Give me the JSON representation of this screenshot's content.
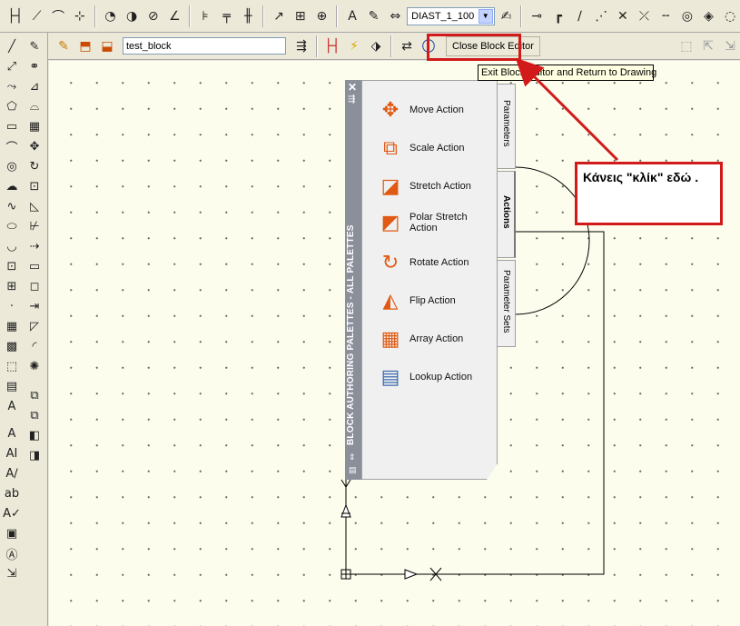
{
  "top_toolbar": {
    "icons": [
      "dim-linear-icon",
      "dim-aligned-icon",
      "dim-arc-icon",
      "dim-ordinate-icon",
      "dim-radius-icon",
      "dim-jogged-icon",
      "dim-diameter-icon",
      "dim-angular-icon",
      "quick-dim-icon",
      "baseline-icon",
      "continue-icon",
      "leader-icon",
      "tolerance-icon",
      "center-mark-icon",
      "dim-edit-icon",
      "dim-text-edit-icon"
    ],
    "dimstyle_value": "DIAST_1_100"
  },
  "block_toolbar": {
    "block_name": "test_block",
    "close_label": "Close Block Editor",
    "tooltip": "Exit Block Editor and Return to Drawing"
  },
  "palette": {
    "title": "BLOCK AUTHORING PALETTES - ALL PALETTES",
    "actions": [
      {
        "label": "Move Action",
        "icon": "move-action-icon"
      },
      {
        "label": "Scale Action",
        "icon": "scale-action-icon"
      },
      {
        "label": "Stretch Action",
        "icon": "stretch-action-icon"
      },
      {
        "label": "Polar Stretch Action",
        "icon": "polar-stretch-action-icon"
      },
      {
        "label": "Rotate Action",
        "icon": "rotate-action-icon"
      },
      {
        "label": "Flip Action",
        "icon": "flip-action-icon"
      },
      {
        "label": "Array Action",
        "icon": "array-action-icon"
      },
      {
        "label": "Lookup Action",
        "icon": "lookup-action-icon"
      }
    ],
    "tabs": [
      "Parameters",
      "Actions",
      "Parameter Sets"
    ]
  },
  "callout": {
    "text": "Κάνεις \"κλίκ\" εδώ ."
  },
  "colors": {
    "highlight": "#d21a1a",
    "canvas_bg": "#fdfdee",
    "palette_bar": "#8a8f9a"
  }
}
